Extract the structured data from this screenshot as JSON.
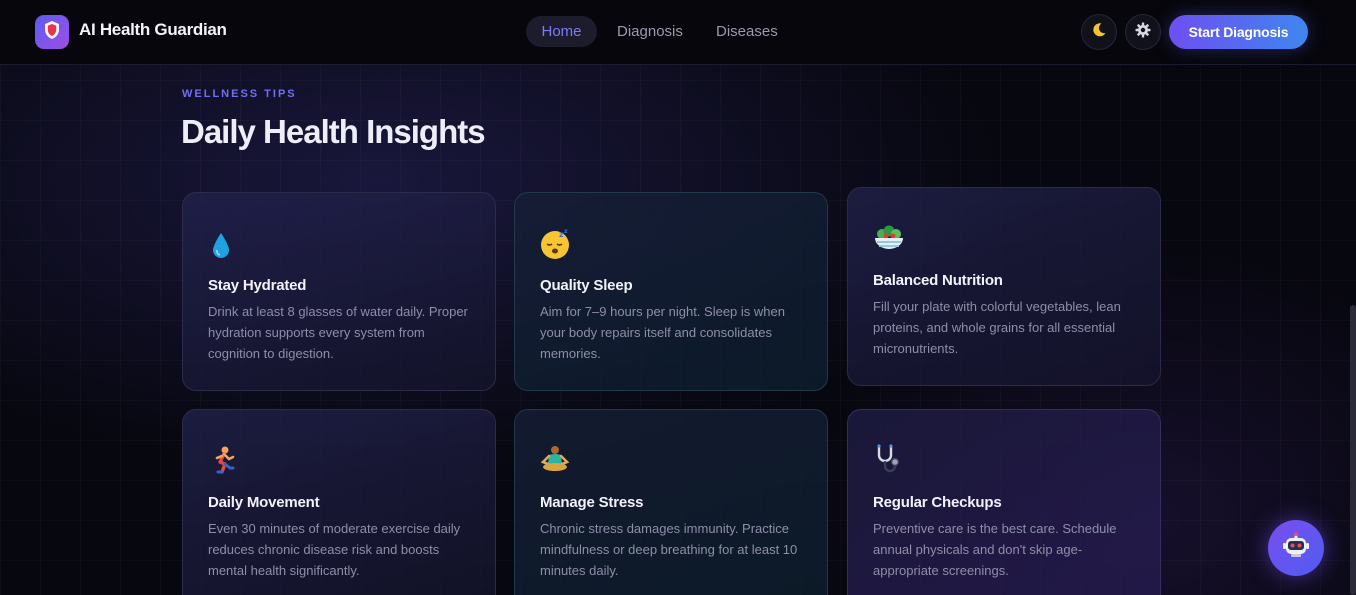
{
  "header": {
    "brand": "AI Health Guardian",
    "logo_icon": "shield-icon",
    "nav": [
      "Home",
      "Diagnosis",
      "Diseases"
    ],
    "active_nav": "Home",
    "theme_icon": "moon-icon",
    "settings_icon": "gear-icon",
    "cta_label": "Start Diagnosis"
  },
  "section": {
    "eyebrow": "WELLNESS TIPS",
    "title": "Daily Health Insights"
  },
  "cards": [
    {
      "icon": "water-drop-icon",
      "title": "Stay Hydrated",
      "text": "Drink at least 8 glasses of water daily. Proper hydration supports every system from cognition to digestion."
    },
    {
      "icon": "sleeping-face-icon",
      "title": "Quality Sleep",
      "text": "Aim for 7–9 hours per night. Sleep is when your body repairs itself and consolidates memories."
    },
    {
      "icon": "salad-bowl-icon",
      "title": "Balanced Nutrition",
      "text": "Fill your plate with colorful vegetables, lean proteins, and whole grains for all essential micronutrients."
    },
    {
      "icon": "running-person-icon",
      "title": "Daily Movement",
      "text": "Even 30 minutes of moderate exercise daily reduces chronic disease risk and boosts mental health significantly."
    },
    {
      "icon": "meditation-person-icon",
      "title": "Manage Stress",
      "text": "Chronic stress damages immunity. Practice mindfulness or deep breathing for at least 10 minutes daily."
    },
    {
      "icon": "stethoscope-icon",
      "title": "Regular Checkups",
      "text": "Preventive care is the best care. Schedule annual physicals and don't skip age-appropriate screenings."
    }
  ],
  "chat_button_icon": "robot-icon",
  "colors": {
    "accent": "#6d4ff0",
    "accent_blue": "#3f86f0",
    "background": "#07070f"
  }
}
